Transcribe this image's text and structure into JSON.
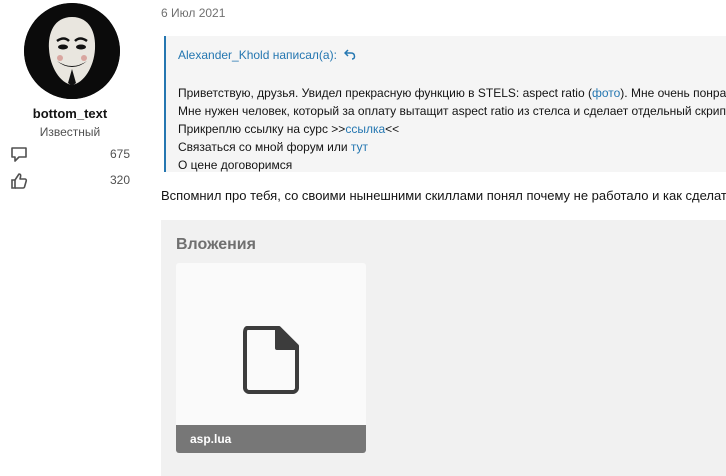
{
  "author": {
    "username": "bottom_text",
    "title": "Известный",
    "messages": "675",
    "reactions": "320"
  },
  "post": {
    "date": "6 Июл 2021",
    "quote": {
      "header": "Alexander_Khold написал(а):",
      "lines": [
        {
          "before": "Приветствую, друзья. Увидел прекрасную функцию в STELS: aspect ratio (",
          "link": "фото",
          "after": "). Мне очень понрави"
        },
        {
          "before": "Мне нужен человек, который за оплату вытащит aspect ratio из стелса и сделает отдельный скрипт",
          "link": "",
          "after": ""
        },
        {
          "before": "Прикреплю ссылку на сурс >>",
          "link": "ссылка",
          "after": "<<"
        },
        {
          "before": "Связаться со мной форум или ",
          "link": "тут",
          "after": ""
        },
        {
          "before": "О цене договоримся",
          "link": "",
          "after": ""
        }
      ]
    },
    "reply": "Вспомнил про тебя, со своими нынешними скиллами понял почему не работало и как сделать"
  },
  "attachments": {
    "heading": "Вложения",
    "files": [
      {
        "name": "asp.lua",
        "icon": "file-icon"
      }
    ]
  },
  "icons": {
    "messages": "messages-icon",
    "reactions": "thumbs-up-icon"
  },
  "colors": {
    "link": "#2577b1",
    "quote_bg": "#f5f5f5",
    "attach_bg": "#f1f1f1",
    "file_label_bg": "#777777"
  }
}
